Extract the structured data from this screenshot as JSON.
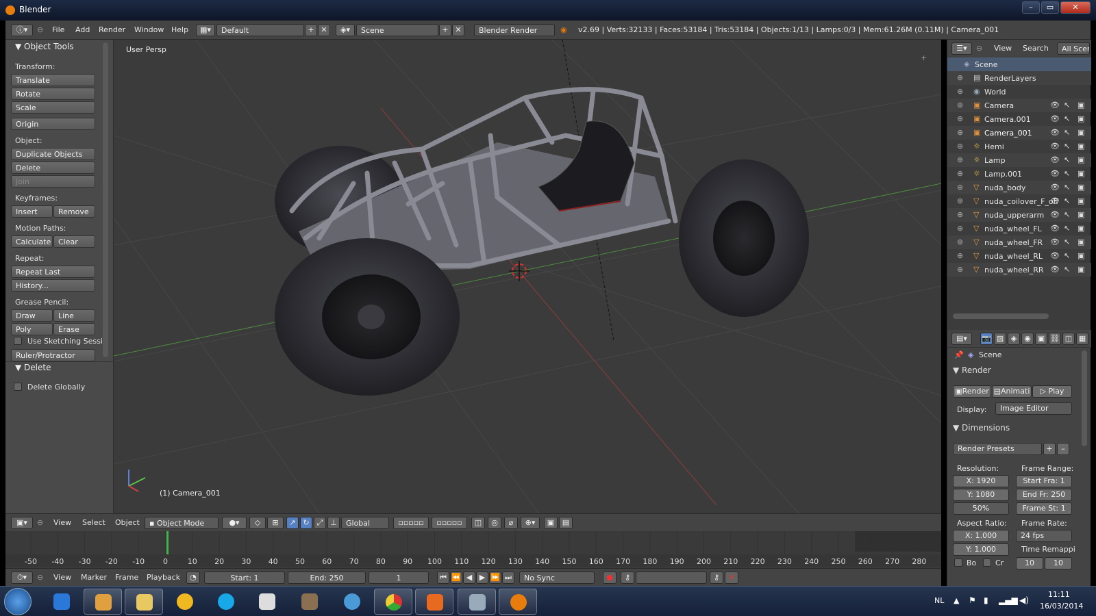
{
  "window": {
    "title": "Blender"
  },
  "menu": {
    "items": [
      "File",
      "Add",
      "Render",
      "Window",
      "Help"
    ]
  },
  "screen_layout": "Default",
  "scene_name": "Scene",
  "render_engine": "Blender Render",
  "stats": "v2.69 | Verts:32133 | Faces:53184 | Tris:53184 | Objects:1/13 | Lamps:0/3 | Mem:61.26M (0.11M) | Camera_001",
  "tools": {
    "title": "Object Tools",
    "transform_label": "Transform:",
    "translate": "Translate",
    "rotate": "Rotate",
    "scale": "Scale",
    "origin": "Origin",
    "object_label": "Object:",
    "duplicate": "Duplicate Objects",
    "delete": "Delete",
    "join": "Join",
    "keyframes_label": "Keyframes:",
    "insert": "Insert",
    "remove": "Remove",
    "motion_label": "Motion Paths:",
    "calculate": "Calculate",
    "clear": "Clear",
    "repeat_label": "Repeat:",
    "repeat_last": "Repeat Last",
    "history": "History...",
    "grease_label": "Grease Pencil:",
    "draw": "Draw",
    "line": "Line",
    "poly": "Poly",
    "erase": "Erase",
    "sketching": "Use Sketching Sessi",
    "ruler": "Ruler/Protractor",
    "delete_section": "Delete",
    "delete_globally": "Delete Globally"
  },
  "viewport": {
    "label": "User Persp",
    "object_label": "(1) Camera_001"
  },
  "v3d_header": {
    "view": "View",
    "select": "Select",
    "object": "Object",
    "mode": "Object Mode",
    "orientation": "Global"
  },
  "timeline": {
    "ticks": [
      "-50",
      "-40",
      "-30",
      "-20",
      "-10",
      "0",
      "10",
      "20",
      "30",
      "40",
      "50",
      "60",
      "70",
      "80",
      "90",
      "100",
      "110",
      "120",
      "130",
      "140",
      "150",
      "160",
      "170",
      "180",
      "190",
      "200",
      "210",
      "220",
      "230",
      "240",
      "250",
      "260",
      "270",
      "280"
    ],
    "view": "View",
    "marker": "Marker",
    "frame": "Frame",
    "playback": "Playback",
    "start": "Start: 1",
    "end": "End: 250",
    "current": "1",
    "sync": "No Sync"
  },
  "outliner": {
    "view": "View",
    "search": "Search",
    "filter": "All Scene",
    "items": [
      {
        "name": "Scene",
        "icon": "scene-icon",
        "level": 0
      },
      {
        "name": "RenderLayers",
        "icon": "renderlayers-icon",
        "level": 1
      },
      {
        "name": "World",
        "icon": "world-icon",
        "level": 1
      },
      {
        "name": "Camera",
        "icon": "camera-icon",
        "level": 1
      },
      {
        "name": "Camera.001",
        "icon": "camera-icon",
        "level": 1
      },
      {
        "name": "Camera_001",
        "icon": "camera-icon",
        "level": 1
      },
      {
        "name": "Hemi",
        "icon": "lamp-icon",
        "level": 1
      },
      {
        "name": "Lamp",
        "icon": "lamp-icon",
        "level": 1
      },
      {
        "name": "Lamp.001",
        "icon": "lamp-icon",
        "level": 1
      },
      {
        "name": "nuda_body",
        "icon": "mesh-icon",
        "level": 1
      },
      {
        "name": "nuda_coilover_F_off",
        "icon": "mesh-icon",
        "level": 1
      },
      {
        "name": "nuda_upperarm",
        "icon": "mesh-icon",
        "level": 1
      },
      {
        "name": "nuda_wheel_FL",
        "icon": "mesh-icon",
        "level": 1
      },
      {
        "name": "nuda_wheel_FR",
        "icon": "mesh-icon",
        "level": 1
      },
      {
        "name": "nuda_wheel_RL",
        "icon": "mesh-icon",
        "level": 1
      },
      {
        "name": "nuda_wheel_RR",
        "icon": "mesh-icon",
        "level": 1
      }
    ]
  },
  "properties": {
    "scene": "Scene",
    "render_section": "Render",
    "render_btn": "Render",
    "anim_btn": "Animati",
    "play_btn": "Play",
    "display_label": "Display:",
    "display_value": "Image Editor",
    "dimensions_section": "Dimensions",
    "presets": "Render Presets",
    "resolution_label": "Resolution:",
    "res_x": "X: 1920",
    "res_y": "Y: 1080",
    "res_pct": "50%",
    "frame_range_label": "Frame Range:",
    "start_fra": "Start Fra: 1",
    "end_fr": "End Fr: 250",
    "frame_st": "Frame St: 1",
    "aspect_label": "Aspect Ratio:",
    "asp_x": "X: 1.000",
    "asp_y": "Y: 1.000",
    "frame_rate_label": "Frame Rate:",
    "fps": "24 fps",
    "remap_label": "Time Remappi",
    "bo": "Bo",
    "cr": "Cr",
    "remap_old": "10",
    "remap_new": "10"
  },
  "taskbar": {
    "lang": "NL",
    "time": "11:11",
    "date": "16/03/2014"
  }
}
